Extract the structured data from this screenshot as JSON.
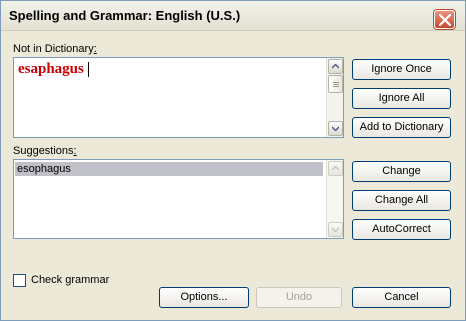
{
  "dialog": {
    "title": "Spelling and Grammar: English (U.S.)"
  },
  "not_in_dictionary": {
    "label": "Not in Dictionary",
    "label_colon": ":",
    "word": "esaphagus"
  },
  "suggestions": {
    "label": "Suggestions",
    "label_colon": ":",
    "items": [
      "esophagus"
    ],
    "selected_index": 0
  },
  "buttons": {
    "ignore_once": "Ignore Once",
    "ignore_all": "Ignore All",
    "add_to_dictionary": "Add to Dictionary",
    "change": "Change",
    "change_all": "Change All",
    "autocorrect": "AutoCorrect",
    "options": "Options...",
    "undo": "Undo",
    "cancel": "Cancel"
  },
  "check_grammar": {
    "label": "Check grammar",
    "checked": false
  },
  "colors": {
    "misspelled_word": "#cc0000",
    "selection": "#c0c0c8",
    "close_button": "#c9462b"
  }
}
